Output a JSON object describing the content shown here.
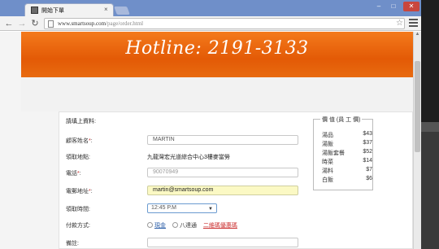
{
  "browser": {
    "tab_title": "開始下單",
    "tab_close": "×",
    "url_domain": "www.smartsoup.com",
    "url_path": "/page/order.html",
    "window_controls": {
      "minimize": "–",
      "maximize": "□",
      "close": "✕"
    }
  },
  "hero": {
    "text": "Hotline: 2191-3133"
  },
  "form": {
    "section_title": "請填上資料:",
    "rows": [
      {
        "label": "顧客姓名",
        "required": "*",
        "value": "MARTIN"
      },
      {
        "label": "領取地點",
        "value": "九龍灣宏光道綜合中心3樓麥當勞"
      },
      {
        "label": "電話",
        "required": "*",
        "value": "90070949"
      },
      {
        "label": "電郵地址",
        "required": "*",
        "value": "martin@smartsoup.com"
      },
      {
        "label": "領取時間",
        "value": "12:45 P.M"
      },
      {
        "label": "付款方式",
        "options": [
          "現金",
          "八達通"
        ],
        "link_text": "二維碼優惠碼"
      },
      {
        "label": "備註"
      }
    ]
  },
  "price_list": {
    "legend": "價 值 (員 工 價)",
    "items": [
      {
        "name": "湯品",
        "price": "$43"
      },
      {
        "name": "湯飯",
        "price": "$37"
      },
      {
        "name": "湯飯套餐",
        "price": "$52"
      },
      {
        "name": "時菜",
        "price": "$14"
      },
      {
        "name": "湯料",
        "price": "$7"
      },
      {
        "name": "白飯",
        "price": "$6"
      }
    ]
  },
  "colors": {
    "brand_orange": "#e35a06",
    "titlebar": "#6f8fc9",
    "filled_field": "#fbf9c4"
  }
}
